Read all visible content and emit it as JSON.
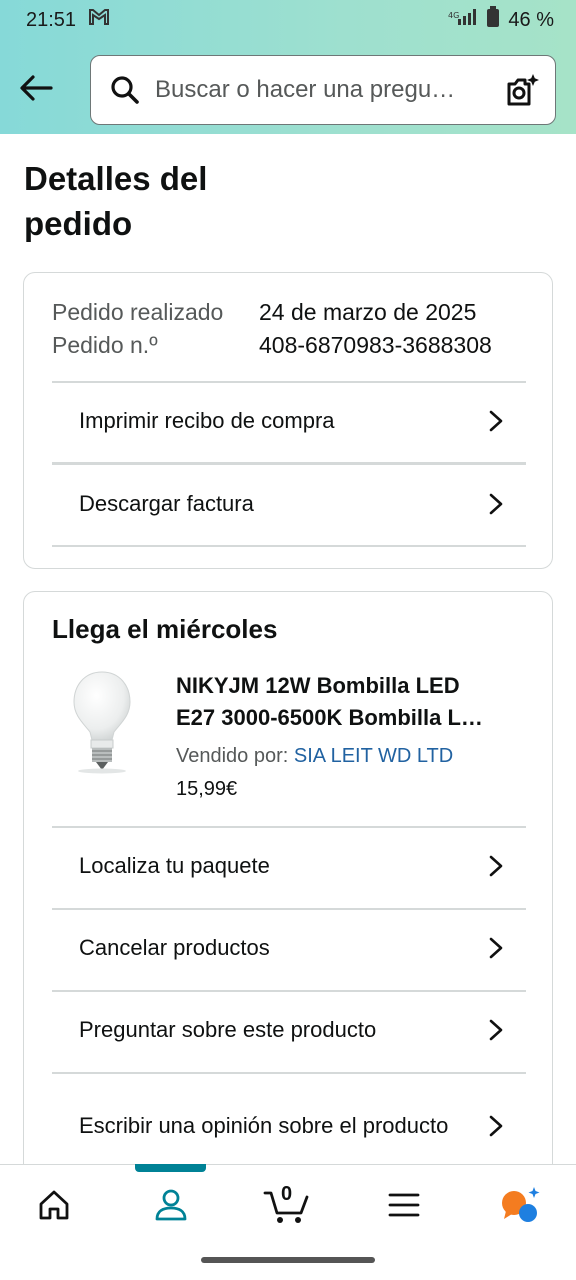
{
  "status_bar": {
    "time": "21:51",
    "battery": "46 %"
  },
  "header": {
    "search_placeholder": "Buscar o hacer una pregu…"
  },
  "page": {
    "title": "Detalles del pedido"
  },
  "order_info": {
    "placed_label": "Pedido realizado",
    "placed_value": "24 de marzo de 2025",
    "number_label": "Pedido n.º",
    "number_value": "408-6870983-3688308",
    "actions": [
      "Imprimir recibo de compra",
      "Descargar factura"
    ]
  },
  "shipment": {
    "heading": "Llega el miércoles",
    "product": {
      "name_line1": "NIKYJM 12W Bombilla LED",
      "name_line2": "E27 3000-6500K Bombilla L…",
      "seller_label": "Vendido por:",
      "seller_name": "SIA LEIT WD LTD",
      "price": "15,99€"
    },
    "actions": [
      "Localiza tu paquete",
      "Cancelar productos",
      "Preguntar sobre este producto",
      "Escribir una opinión sobre el producto"
    ]
  },
  "bottom_nav": {
    "cart_count": "0",
    "active": "account",
    "accent_color": "#008296"
  }
}
